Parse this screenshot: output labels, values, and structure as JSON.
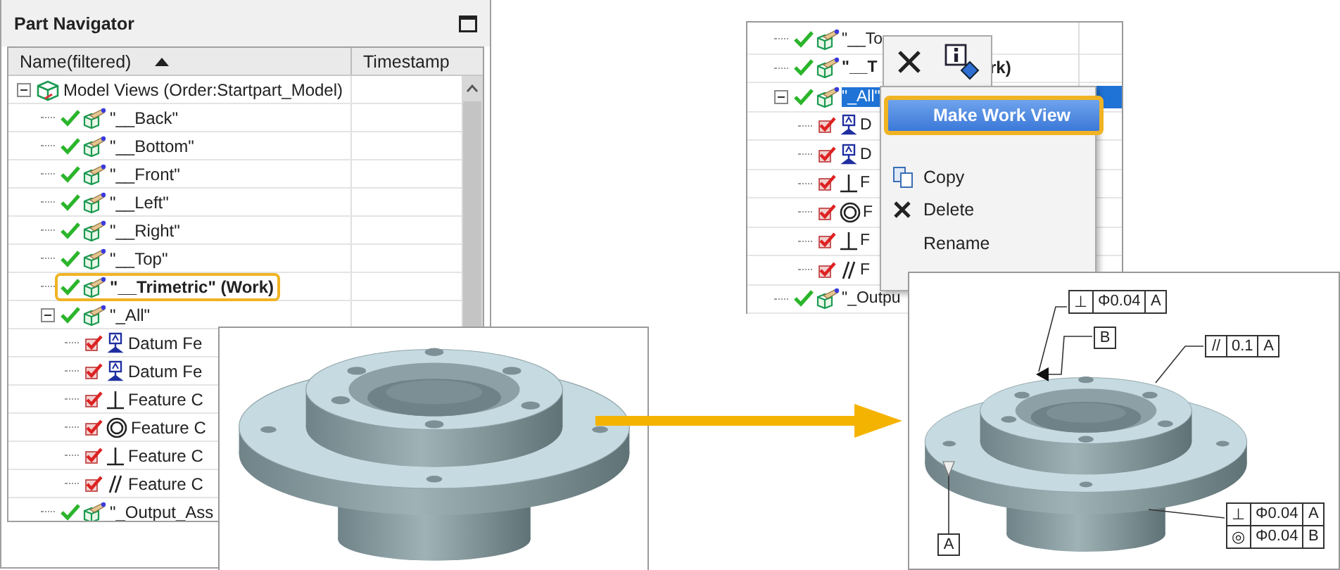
{
  "part_navigator": {
    "title": "Part Navigator",
    "columns": [
      {
        "label": "Name(filtered)",
        "sorted": true
      },
      {
        "label": "Timestamp",
        "sorted": false
      }
    ],
    "tree": [
      {
        "label": "Model Views (Order:Startpart_Model)",
        "kind": "group",
        "expanded": true,
        "children": [
          {
            "label": "\"__Back\"",
            "kind": "view",
            "work": false
          },
          {
            "label": "\"__Bottom\"",
            "kind": "view",
            "work": false
          },
          {
            "label": "\"__Front\"",
            "kind": "view",
            "work": false
          },
          {
            "label": "\"__Left\"",
            "kind": "view",
            "work": false
          },
          {
            "label": "\"__Right\"",
            "kind": "view",
            "work": false
          },
          {
            "label": "\"__Top\"",
            "kind": "view",
            "work": false
          },
          {
            "label": "\"__Trimetric\" (Work)",
            "kind": "view",
            "work": true
          },
          {
            "label": "\"_All\"",
            "kind": "view",
            "work": false,
            "expanded": true,
            "children": [
              {
                "label": "Datum Fe",
                "kind": "datum"
              },
              {
                "label": "Datum Fe",
                "kind": "datum"
              },
              {
                "label": "Feature C",
                "kind": "perpendicularity"
              },
              {
                "label": "Feature C",
                "kind": "concentricity"
              },
              {
                "label": "Feature C",
                "kind": "perpendicularity"
              },
              {
                "label": "Feature C",
                "kind": "parallelism"
              }
            ]
          },
          {
            "label": "\"_Output_Ass",
            "kind": "view",
            "work": false
          }
        ]
      }
    ]
  },
  "context_example": {
    "tree": [
      {
        "label": "\"__To",
        "kind": "view",
        "work": false,
        "selected": false
      },
      {
        "label": "\"__T",
        "tail": "rk)",
        "kind": "view",
        "work": true,
        "selected": false
      },
      {
        "label": "\"_All\"",
        "kind": "view",
        "work": false,
        "selected": true,
        "expanded": true,
        "children": [
          {
            "label": "D",
            "kind": "datum",
            "selected": false
          },
          {
            "label": "D",
            "kind": "datum",
            "selected": false
          },
          {
            "label": "F",
            "kind": "perpendicularity",
            "selected": false
          },
          {
            "label": "F",
            "kind": "concentricity",
            "selected": false
          },
          {
            "label": "F",
            "kind": "perpendicularity",
            "selected": false
          },
          {
            "label": "F",
            "kind": "parallelism",
            "selected": false
          }
        ]
      },
      {
        "label": "\"_Outpu",
        "kind": "view",
        "work": false,
        "selected": false
      }
    ],
    "toolbar": [
      {
        "kind": "delete"
      },
      {
        "kind": "info"
      }
    ],
    "menu": [
      {
        "label": "Make Work View",
        "kind": "default",
        "selected": true
      },
      {
        "label": "Copy",
        "kind": "copy",
        "selected": false
      },
      {
        "label": "Delete",
        "kind": "delete",
        "selected": false
      },
      {
        "label": "Rename",
        "kind": "plain",
        "selected": false
      }
    ]
  },
  "annotated_view": {
    "frames": [
      {
        "cells": [
          "⊥",
          "Φ0.04",
          "A"
        ]
      },
      {
        "cells": [
          "B"
        ]
      },
      {
        "cells": [
          "//",
          "0.1",
          "A"
        ]
      },
      {
        "cells": [
          "A"
        ]
      },
      {
        "rows": [
          [
            "⊥",
            "Φ0.04",
            "A"
          ],
          [
            "◎",
            "Φ0.04",
            "B"
          ]
        ]
      }
    ]
  }
}
